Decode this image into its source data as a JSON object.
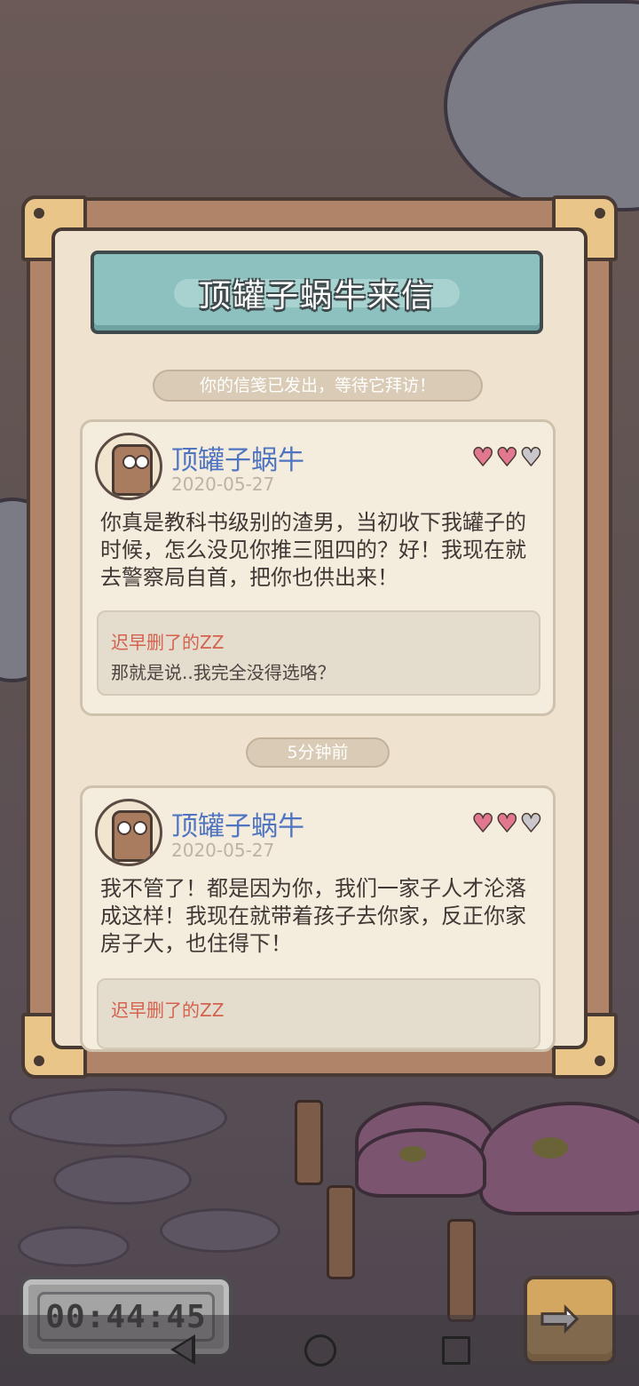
{
  "window": {
    "title": "顶罐子蜗牛来信"
  },
  "status": {
    "sent_message": "你的信笺已发出，等待它拜访！"
  },
  "letters": [
    {
      "sender": "顶罐子蜗牛",
      "date": "2020-05-27",
      "hearts_filled": 2,
      "hearts_total": 3,
      "message": "你真是教科书级别的渣男，当初收下我罐子的时候，怎么没见你推三阻四的？好！我现在就去警察局自首，把你也供出来！",
      "reply": {
        "name": "迟早删了的ZZ",
        "text": "那就是说..我完全没得选咯？"
      }
    },
    {
      "sender": "顶罐子蜗牛",
      "date": "2020-05-27",
      "hearts_filled": 2,
      "hearts_total": 3,
      "message": "我不管了！都是因为你，我们一家子人才沦落成这样！我现在就带着孩子去你家，反正你家房子大，也住得下！",
      "reply": {
        "name": "迟早删了的ZZ",
        "text": ""
      }
    }
  ],
  "divider": {
    "time_ago": "5分钟前"
  },
  "timer": {
    "value": "00:44:45"
  },
  "icons": {
    "heart": "heart-icon",
    "next": "arrow-right-icon",
    "back": "nav-back-icon",
    "home": "nav-home-icon",
    "recent": "nav-recent-icon"
  },
  "colors": {
    "sender_name": "#4f74c2",
    "reply_name": "#d3624f",
    "heart_full": "#e2788f",
    "heart_empty": "#c9c6cc",
    "banner": "#8dc1bf",
    "paper": "#efe3cf"
  }
}
